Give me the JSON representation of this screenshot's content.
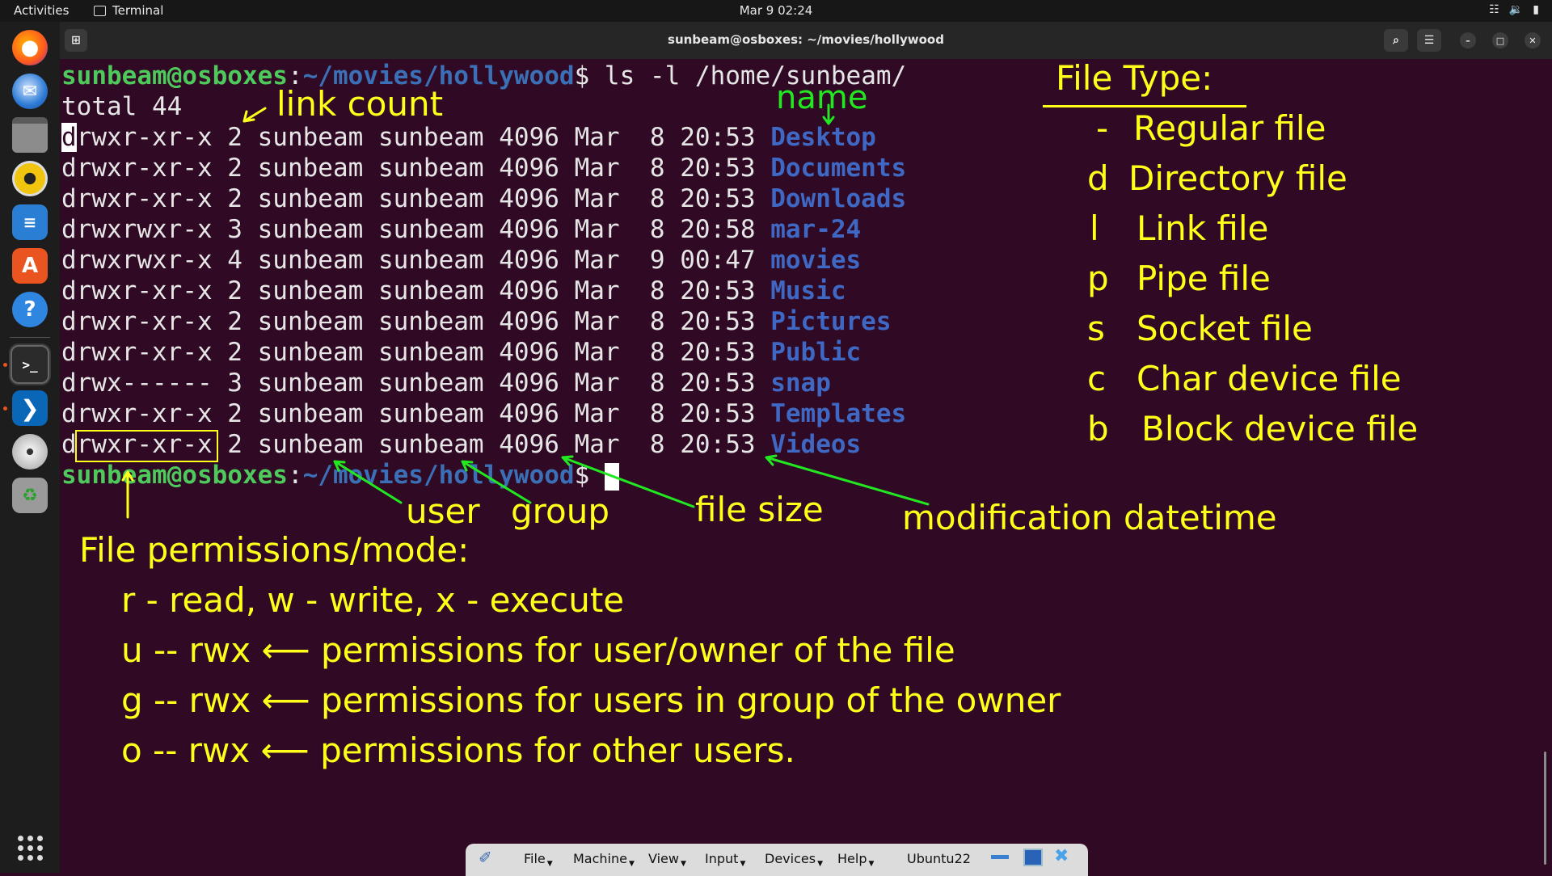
{
  "topbar": {
    "activities": "Activities",
    "app_name": "Terminal",
    "clock": "Mar 9  02:24",
    "tray": [
      "network-icon",
      "volume-icon",
      "battery-icon"
    ]
  },
  "dock": {
    "items": [
      "firefox-icon",
      "thunderbird-icon",
      "files-icon",
      "rhythmbox-icon",
      "libreoffice-writer-icon",
      "app-center-icon",
      "help-icon",
      "terminal-icon",
      "vscode-icon",
      "dvd-icon",
      "trash-icon",
      "show-apps-icon"
    ]
  },
  "window": {
    "title": "sunbeam@osboxes: ~/movies/hollywood"
  },
  "terminal": {
    "prompt_user": "sunbeam@osboxes",
    "prompt_colon": ":",
    "prompt_path": "~/movies/hollywood",
    "prompt_dollar": "$ ",
    "command": "ls -l /home/sunbeam/",
    "total": "total 44",
    "rows": [
      {
        "first": "d",
        "rest": "rwxr-xr-x 2 sunbeam sunbeam 4096 Mar  8 20:53 ",
        "name": "Desktop"
      },
      {
        "first": "d",
        "rest": "rwxr-xr-x 2 sunbeam sunbeam 4096 Mar  8 20:53 ",
        "name": "Documents"
      },
      {
        "first": "d",
        "rest": "rwxr-xr-x 2 sunbeam sunbeam 4096 Mar  8 20:53 ",
        "name": "Downloads"
      },
      {
        "first": "d",
        "rest": "rwxrwxr-x 3 sunbeam sunbeam 4096 Mar  8 20:58 ",
        "name": "mar-24"
      },
      {
        "first": "d",
        "rest": "rwxrwxr-x 4 sunbeam sunbeam 4096 Mar  9 00:47 ",
        "name": "movies"
      },
      {
        "first": "d",
        "rest": "rwxr-xr-x 2 sunbeam sunbeam 4096 Mar  8 20:53 ",
        "name": "Music"
      },
      {
        "first": "d",
        "rest": "rwxr-xr-x 2 sunbeam sunbeam 4096 Mar  8 20:53 ",
        "name": "Pictures"
      },
      {
        "first": "d",
        "rest": "rwxr-xr-x 2 sunbeam sunbeam 4096 Mar  8 20:53 ",
        "name": "Public"
      },
      {
        "first": "d",
        "rest": "rwx------ 3 sunbeam sunbeam 4096 Mar  8 20:53 ",
        "name": "snap"
      },
      {
        "first": "d",
        "rest": "rwxr-xr-x 2 sunbeam sunbeam 4096 Mar  8 20:53 ",
        "name": "Templates"
      },
      {
        "first": "d",
        "rest": "rwxr-xr-x 2 sunbeam sunbeam 4096 Mar  8 20:53 ",
        "name": "Videos"
      }
    ]
  },
  "annotations": {
    "link_count": "link count",
    "name": "name",
    "user": "user",
    "group": "group",
    "file_size": "file size",
    "mod_datetime": "modification datetime",
    "file_type_title": "File Type:",
    "file_types": [
      {
        "sym": "-",
        "desc": "Regular file"
      },
      {
        "sym": "d",
        "desc": "Directory file"
      },
      {
        "sym": "l",
        "desc": "Link file"
      },
      {
        "sym": "p",
        "desc": "Pipe file"
      },
      {
        "sym": "s",
        "desc": "Socket file"
      },
      {
        "sym": "c",
        "desc": "Char device file"
      },
      {
        "sym": "b",
        "desc": "Block device file"
      }
    ],
    "perm_title": "File permissions/mode:",
    "perm_lines": [
      "r - read, w - write, x - execute",
      "u -- rwx ⟵ permissions for user/owner of the file",
      "g -- rwx ⟵ permissions for users in group of the owner",
      "o -- rwx ⟵ permissions for other users."
    ]
  },
  "vbox": {
    "menus": [
      "File",
      "Machine",
      "View",
      "Input",
      "Devices",
      "Help"
    ],
    "vm_name": "Ubuntu22"
  },
  "colors": {
    "terminal_bg": "#300a24",
    "prompt_user": "#4ec95b",
    "prompt_path": "#3b6fb6",
    "directory": "#3f68c4",
    "annotation_yellow": "#ffff1a",
    "annotation_green": "#22e822"
  }
}
